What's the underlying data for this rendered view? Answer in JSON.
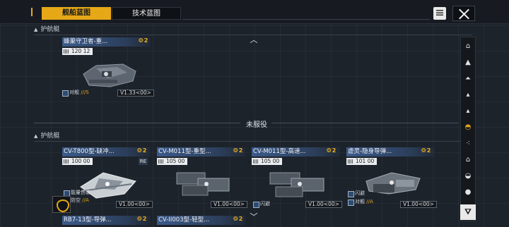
{
  "tabs": {
    "active": "舰船蓝图",
    "inactive": "技术蓝图"
  },
  "sections": {
    "top_category": "护航艇",
    "divider": "未服役",
    "bottom_category": "护航艇"
  },
  "cards": [
    {
      "name": "蜂巢守卫者-重...",
      "badge": "2",
      "cost": "120",
      "cost_max": "12",
      "re": "",
      "trait1": "",
      "trait2": "对舰",
      "trait2_mark": "///S",
      "version": "V1.33<00>"
    },
    {
      "name": "CV-T800型-缺冲...",
      "badge": "2",
      "cost": "100",
      "cost_max": "00",
      "re": "RE",
      "trait1": "能量伤害",
      "trait2": "防空",
      "trait2_mark": "//A",
      "version": "V1.00<00>"
    },
    {
      "name": "CV-M011型-重型...",
      "badge": "2",
      "cost": "105",
      "cost_max": "00",
      "re": "",
      "trait1": "",
      "trait2": "",
      "trait2_mark": "",
      "version": "V1.00<00>"
    },
    {
      "name": "CV-M011型-高速...",
      "badge": "2",
      "cost": "105",
      "cost_max": "00",
      "re": "",
      "trait1": "",
      "trait2": "闪避",
      "trait2_mark": "",
      "version": "V1.00<00>"
    },
    {
      "name": "虚灵-隐身导弹...",
      "badge": "2",
      "cost": "101",
      "cost_max": "00",
      "re": "",
      "trait1": "闪避",
      "trait2": "对舰",
      "trait2_mark": "//A",
      "version": "V1.00<00>"
    },
    {
      "name": "RB7-13型-导弹...",
      "badge": "2"
    },
    {
      "name": "CV-II003型-轻型...",
      "badge": "2"
    }
  ],
  "rail_icons": [
    "hangar-icon",
    "carrier-icon",
    "cruiser-icon",
    "destroyer-icon",
    "frigate-icon",
    "corvette-icon",
    "fighter-group-icon",
    "capital-icon",
    "dome-icon",
    "station-icon"
  ],
  "colors": {
    "accent": "#e6a817",
    "name_bar": "#3a5a8a"
  }
}
